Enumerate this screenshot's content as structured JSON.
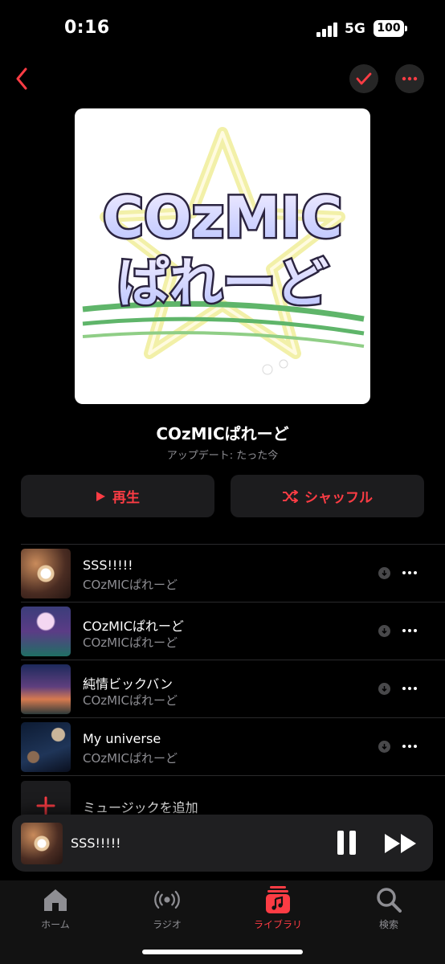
{
  "status": {
    "time": "0:16",
    "network": "5G",
    "battery": "100"
  },
  "colors": {
    "accent": "#fc3c44",
    "background": "#000000",
    "surface": "#1c1c1e"
  },
  "playlist": {
    "title": "COzMICぱれーど",
    "updated": "アップデート: たった今",
    "artwork_text_line1": "COzMIC",
    "artwork_text_line2": "ぱれーど"
  },
  "actions": {
    "play_label": "再生",
    "shuffle_label": "シャッフル"
  },
  "tracks": [
    {
      "title": "SSS!!!!!",
      "artist": "COzMICぱれーど"
    },
    {
      "title": "COzMICぱれーど",
      "artist": "COzMICぱれーど"
    },
    {
      "title": "純情ビックバン",
      "artist": "COzMICぱれーど"
    },
    {
      "title": "My universe",
      "artist": "COzMICぱれーど"
    }
  ],
  "add_music_label": "ミュージックを追加",
  "now_playing": {
    "title": "SSS!!!!!"
  },
  "tabs": [
    {
      "label": "ホーム",
      "icon": "house-icon"
    },
    {
      "label": "ラジオ",
      "icon": "radio-icon"
    },
    {
      "label": "ライブラリ",
      "icon": "library-icon",
      "active": true
    },
    {
      "label": "検索",
      "icon": "search-icon"
    }
  ]
}
